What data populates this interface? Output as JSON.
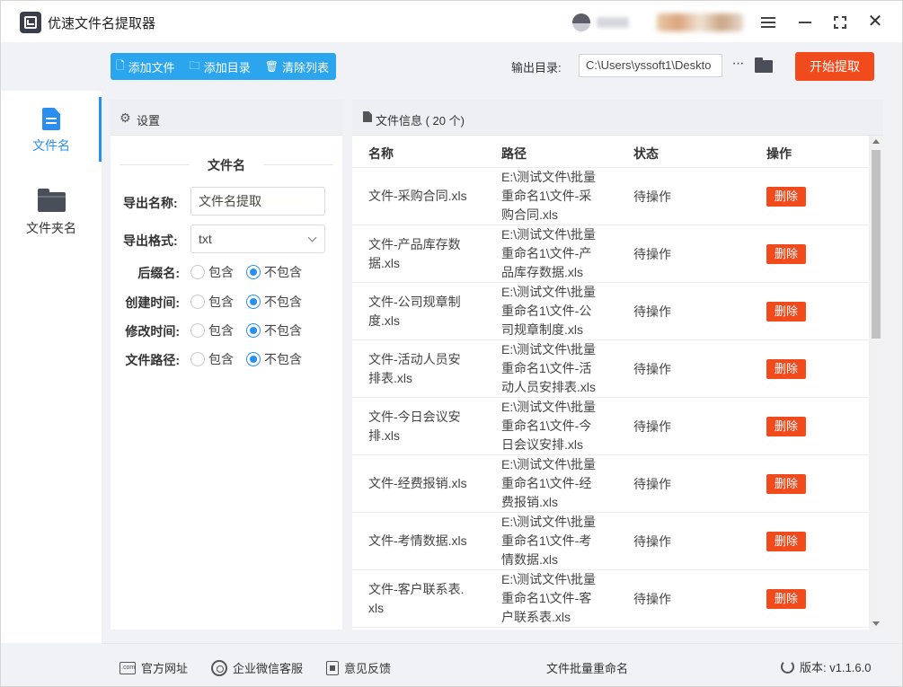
{
  "window": {
    "title": "优速文件名提取器"
  },
  "toolbar": {
    "add_file_label": "添加文件",
    "add_dir_label": "添加目录",
    "clear_list_label": "清除列表",
    "output_dir_label": "输出目录:",
    "output_dir_value": "C:\\Users\\yssoft1\\Deskto",
    "more_label": "···",
    "start_label": "开始提取",
    "accent_color": "#2ba6ee",
    "start_color": "#f14a1d"
  },
  "sidebar": {
    "items": [
      {
        "label": "文件名",
        "icon": "file-icon",
        "active": true
      },
      {
        "label": "文件夹名",
        "icon": "folder-icon",
        "active": false
      }
    ]
  },
  "settings": {
    "header": "设置",
    "section_title": "文件名",
    "export_name_label": "导出名称:",
    "export_name_value": "文件名提取",
    "export_format_label": "导出格式:",
    "export_format_value": "txt",
    "options": [
      {
        "label": "后缀名:",
        "include": "包含",
        "exclude": "不包含",
        "selected": "exclude"
      },
      {
        "label": "创建时间:",
        "include": "包含",
        "exclude": "不包含",
        "selected": "exclude"
      },
      {
        "label": "修改时间:",
        "include": "包含",
        "exclude": "不包含",
        "selected": "exclude"
      },
      {
        "label": "文件路径:",
        "include": "包含",
        "exclude": "不包含",
        "selected": "exclude"
      }
    ]
  },
  "file_info": {
    "header": "文件信息 ( 20 个)",
    "columns": [
      "名称",
      "路径",
      "状态",
      "操作"
    ],
    "rows": [
      {
        "name": [
          "文件-采购合同.xls"
        ],
        "path": [
          "E:\\测试文件\\批量",
          "重命名1\\文件-采",
          "购合同.xls"
        ],
        "status": "待操作",
        "action": "删除"
      },
      {
        "name": [
          "文件-产品库存数",
          "据.xls"
        ],
        "path": [
          "E:\\测试文件\\批量",
          "重命名1\\文件-产",
          "品库存数据.xls"
        ],
        "status": "待操作",
        "action": "删除"
      },
      {
        "name": [
          "文件-公司规章制",
          "度.xls"
        ],
        "path": [
          "E:\\测试文件\\批量",
          "重命名1\\文件-公",
          "司规章制度.xls"
        ],
        "status": "待操作",
        "action": "删除"
      },
      {
        "name": [
          "文件-活动人员安",
          "排表.xls"
        ],
        "path": [
          "E:\\测试文件\\批量",
          "重命名1\\文件-活",
          "动人员安排表.xls"
        ],
        "status": "待操作",
        "action": "删除"
      },
      {
        "name": [
          "文件-今日会议安",
          "排.xls"
        ],
        "path": [
          "E:\\测试文件\\批量",
          "重命名1\\文件-今",
          "日会议安排.xls"
        ],
        "status": "待操作",
        "action": "删除"
      },
      {
        "name": [
          "文件-经费报销.xls"
        ],
        "path": [
          "E:\\测试文件\\批量",
          "重命名1\\文件-经",
          "费报销.xls"
        ],
        "status": "待操作",
        "action": "删除"
      },
      {
        "name": [
          "文件-考情数据.xls"
        ],
        "path": [
          "E:\\测试文件\\批量",
          "重命名1\\文件-考",
          "情数据.xls"
        ],
        "status": "待操作",
        "action": "删除"
      },
      {
        "name": [
          "文件-客户联系表.",
          "xls"
        ],
        "path": [
          "E:\\测试文件\\批量",
          "重命名1\\文件-客",
          "户联系表.xls"
        ],
        "status": "待操作",
        "action": "删除"
      }
    ]
  },
  "footer": {
    "website_label": "官方网址",
    "wechat_label": "企业微信客服",
    "feedback_label": "意见反馈",
    "center_label": "文件批量重命名",
    "version_label": "版本: v1.1.6.0"
  }
}
